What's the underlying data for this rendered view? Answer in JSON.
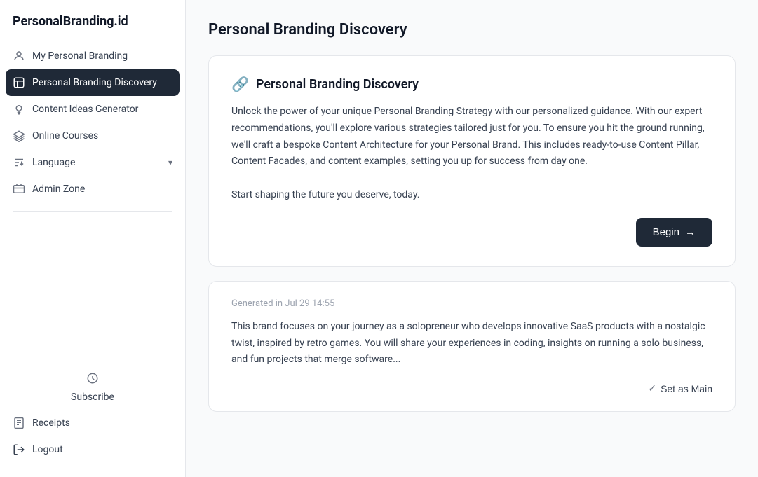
{
  "app": {
    "name": "PersonalBranding.id"
  },
  "sidebar": {
    "logo": "PersonalBranding.id",
    "items": [
      {
        "id": "my-personal-branding",
        "label": "My Personal Branding",
        "icon": "user-icon",
        "active": false
      },
      {
        "id": "personal-branding-discovery",
        "label": "Personal Branding Discovery",
        "icon": "compass-icon",
        "active": true
      },
      {
        "id": "content-ideas-generator",
        "label": "Content Ideas Generator",
        "icon": "bulb-icon",
        "active": false
      },
      {
        "id": "online-courses",
        "label": "Online Courses",
        "icon": "courses-icon",
        "active": false
      },
      {
        "id": "language",
        "label": "Language",
        "icon": "language-icon",
        "active": false,
        "hasChevron": true
      },
      {
        "id": "admin-zone",
        "label": "Admin Zone",
        "icon": "admin-icon",
        "active": false
      }
    ],
    "bottom_items": [
      {
        "id": "subscribe",
        "label": "Subscribe",
        "icon": "subscribe-icon"
      },
      {
        "id": "receipts",
        "label": "Receipts",
        "icon": "receipts-icon"
      },
      {
        "id": "logout",
        "label": "Logout",
        "icon": "logout-icon"
      }
    ]
  },
  "page": {
    "title": "Personal Branding Discovery"
  },
  "discovery_card": {
    "icon": "🔗",
    "title": "Personal Branding Discovery",
    "body": "Unlock the power of your unique Personal Branding Strategy with our personalized guidance. With our expert recommendations, you&apos;ll explore various strategies tailored just for you. To ensure you hit the ground running, we&apos;ll craft a bespoke Content Architecture for your Personal Brand. This includes ready-to-use Content Pillar, Content Facades, and content examples, setting you up for success from day one.\n\nStart shaping the future you deserve, today.",
    "begin_button": "Begin"
  },
  "generated_card": {
    "timestamp": "Generated in Jul 29 14:55",
    "body": "This brand focuses on your journey as a solopreneur who develops innovative SaaS products with a nostalgic twist, inspired by retro games. You will share your experiences in coding, insights on running a solo business, and fun projects that merge software...",
    "set_as_main_label": "Set as Main"
  }
}
